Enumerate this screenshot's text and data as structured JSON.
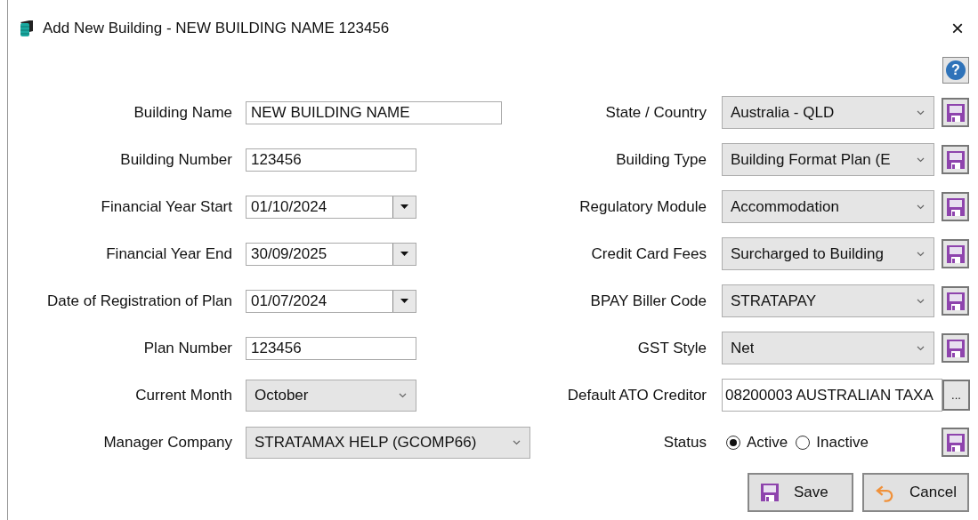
{
  "window": {
    "title": "Add New Building - NEW BUILDING NAME 123456",
    "close": "×"
  },
  "help_button": {
    "label": "?"
  },
  "left_fields": [
    {
      "label": "Building Name",
      "kind": "text",
      "value": "NEW BUILDING NAME"
    },
    {
      "label": "Building Number",
      "kind": "text",
      "value": "123456"
    },
    {
      "label": "Financial Year Start",
      "kind": "date",
      "value": "01/10/2024"
    },
    {
      "label": "Financial Year End",
      "kind": "date",
      "value": "30/09/2025"
    },
    {
      "label": "Date of Registration of Plan",
      "kind": "date",
      "value": "01/07/2024"
    },
    {
      "label": "Plan Number",
      "kind": "text",
      "value": "123456"
    },
    {
      "label": "Current Month",
      "kind": "select",
      "value": "October"
    },
    {
      "label": "Manager Company",
      "kind": "select",
      "value": "STRATAMAX HELP (GCOMP66)"
    }
  ],
  "right_fields": [
    {
      "label": "State / Country",
      "kind": "select",
      "value": "Australia - QLD"
    },
    {
      "label": "Building Type",
      "kind": "select",
      "value": "Building Format Plan (E"
    },
    {
      "label": "Regulatory Module",
      "kind": "select",
      "value": "Accommodation"
    },
    {
      "label": "Credit Card Fees",
      "kind": "select",
      "value": "Surcharged to Building"
    },
    {
      "label": "BPAY Biller Code",
      "kind": "select",
      "value": "STRATAPAY"
    },
    {
      "label": "GST Style",
      "kind": "select",
      "value": "Net"
    },
    {
      "label": "Default ATO Creditor",
      "kind": "lookup",
      "value": "08200003 AUSTRALIAN TAXA",
      "button": "..."
    },
    {
      "label": "Status",
      "kind": "radio",
      "options": [
        {
          "label": "Active",
          "selected": true
        },
        {
          "label": "Inactive",
          "selected": false
        }
      ]
    }
  ],
  "buttons": [
    {
      "label": "Save",
      "kind": "save"
    },
    {
      "label": "Cancel",
      "kind": "cancel"
    }
  ]
}
